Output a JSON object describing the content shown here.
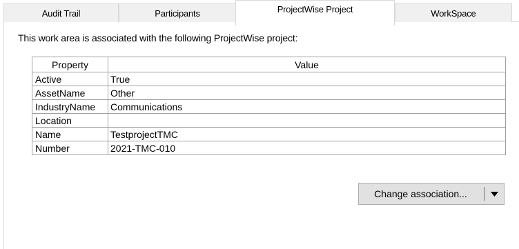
{
  "tabs": [
    {
      "label": "Audit Trail"
    },
    {
      "label": "Participants"
    },
    {
      "label": "ProjectWise Project"
    },
    {
      "label": "WorkSpace"
    }
  ],
  "active_tab": "ProjectWise Project",
  "intro_text": "This work area is associated with the following ProjectWise project:",
  "grid": {
    "headers": {
      "property": "Property",
      "value": "Value"
    },
    "rows": [
      {
        "property": "Active",
        "value": "True"
      },
      {
        "property": "AssetName",
        "value": "Other"
      },
      {
        "property": "IndustryName",
        "value": "Communications"
      },
      {
        "property": "Location",
        "value": ""
      },
      {
        "property": "Name",
        "value": "TestprojectTMC"
      },
      {
        "property": "Number",
        "value": "2021-TMC-010"
      }
    ]
  },
  "change_button": {
    "label": "Change association...",
    "dropdown_icon": "chevron-down-icon"
  },
  "colors": {
    "tab_inactive_bg": "#f0f0f0",
    "button_bg": "#e1e1e1",
    "grid_border": "#a0a0a0"
  }
}
